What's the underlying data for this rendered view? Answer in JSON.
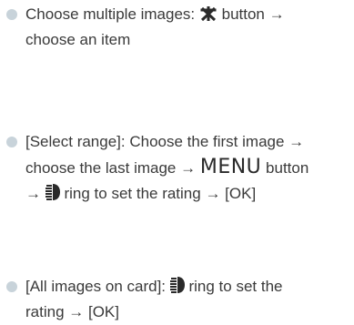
{
  "items": [
    {
      "lines": [
        {
          "before": "Choose multiple images:",
          "icon": "asterisk-icon",
          "after": "button →"
        },
        {
          "text": "choose an item"
        }
      ]
    },
    {
      "lines": [
        {
          "text": "[Select range]: Choose the first image →"
        },
        {
          "before": "choose the last image →",
          "menu": "MENU",
          "after": "button"
        },
        {
          "before": "→",
          "icon": "control-ring-icon",
          "after": "ring to set the rating → [OK]"
        }
      ]
    },
    {
      "lines": [
        {
          "before": "[All images on card]:",
          "icon": "control-ring-icon",
          "after": "ring to set the"
        },
        {
          "text": "rating → [OK]"
        }
      ]
    }
  ],
  "colors": {
    "bullet": "#c8d3da",
    "text": "#3a3a3a"
  }
}
